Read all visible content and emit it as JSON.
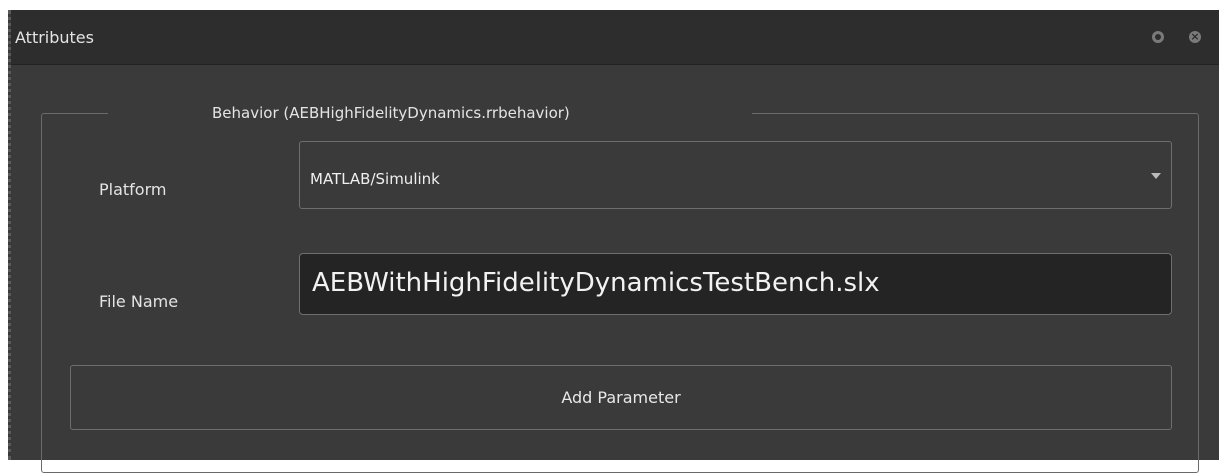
{
  "panel": {
    "title": "Attributes",
    "icons": [
      "settings-icon",
      "close-icon"
    ]
  },
  "behavior_group": {
    "title": "Behavior (AEBHighFidelityDynamics.rrbehavior)",
    "platform_label": "Platform",
    "platform_value": "MATLAB/Simulink",
    "file_name_label": "File Name",
    "file_name_value": "AEBWithHighFidelityDynamicsTestBench.slx",
    "add_parameter_label": "Add Parameter"
  }
}
